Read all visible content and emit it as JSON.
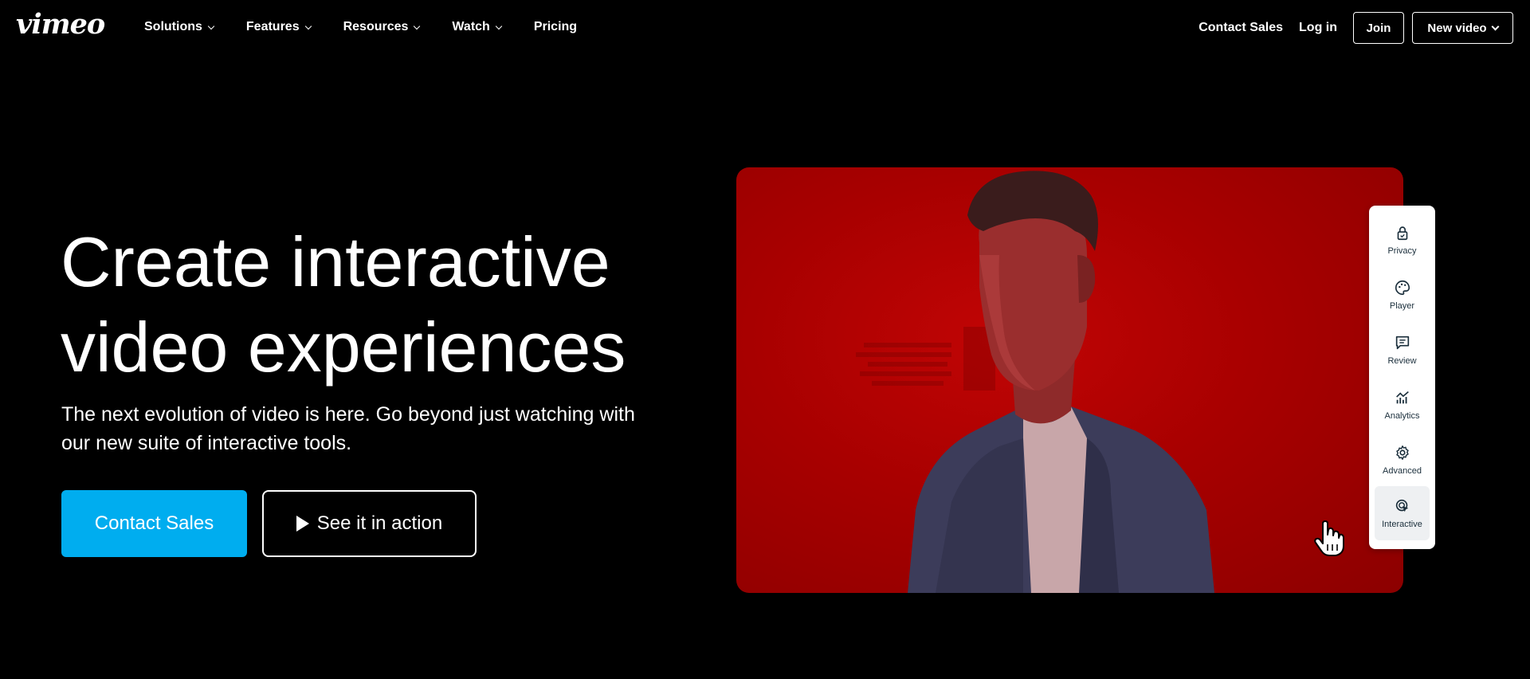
{
  "nav": {
    "logo": "vimeo",
    "items": [
      {
        "label": "Solutions",
        "has_dropdown": true
      },
      {
        "label": "Features",
        "has_dropdown": true
      },
      {
        "label": "Resources",
        "has_dropdown": true
      },
      {
        "label": "Watch",
        "has_dropdown": true
      },
      {
        "label": "Pricing",
        "has_dropdown": false
      }
    ],
    "contact_sales": "Contact Sales",
    "log_in": "Log in",
    "join": "Join",
    "new_video": "New video"
  },
  "hero": {
    "title_line1": "Create interactive",
    "title_line2": "video experiences",
    "subtitle_line1": "The next evolution of video is here. Go beyond just watching with",
    "subtitle_line2": "our new suite of interactive tools.",
    "primary_cta": "Contact Sales",
    "secondary_cta": "See it in action"
  },
  "panel": {
    "items": [
      {
        "label": "Privacy",
        "icon": "lock-icon",
        "active": false
      },
      {
        "label": "Player",
        "icon": "palette-icon",
        "active": false
      },
      {
        "label": "Review",
        "icon": "comment-icon",
        "active": false
      },
      {
        "label": "Analytics",
        "icon": "chart-icon",
        "active": false
      },
      {
        "label": "Advanced",
        "icon": "gear-icon",
        "active": false
      },
      {
        "label": "Interactive",
        "icon": "click-icon",
        "active": true
      }
    ]
  },
  "colors": {
    "background": "#000000",
    "accent": "#00adef",
    "video_red": "#b00000",
    "panel_text": "#1a2e3b"
  }
}
